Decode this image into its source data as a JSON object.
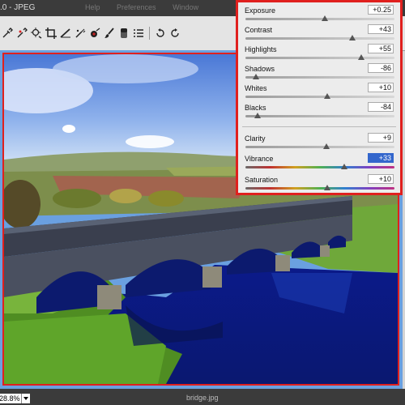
{
  "window": {
    "title": ".0 - JPEG",
    "menu_items": [
      "Help",
      "Preferences",
      "Window"
    ]
  },
  "toolbar": {
    "tools": [
      "zoom-icon",
      "eyedropper-icon",
      "color-sampler-icon",
      "targeted-adjust-icon",
      "crop-icon",
      "straighten-icon",
      "spot-removal-icon",
      "red-eye-icon",
      "adjustment-brush-icon",
      "graduated-filter-icon",
      "list-icon",
      "rotate-ccw-icon",
      "rotate-cw-icon"
    ]
  },
  "panel": {
    "sliders": [
      {
        "label": "Exposure",
        "value": "+0.25",
        "pos": 0.53,
        "track": "gray"
      },
      {
        "label": "Contrast",
        "value": "+43",
        "pos": 0.715,
        "track": "gray"
      },
      {
        "label": "Highlights",
        "value": "+55",
        "pos": 0.775,
        "track": "gray"
      },
      {
        "label": "Shadows",
        "value": "-86",
        "pos": 0.07,
        "track": "gray"
      },
      {
        "label": "Whites",
        "value": "+10",
        "pos": 0.55,
        "track": "gray"
      },
      {
        "label": "Blacks",
        "value": "-84",
        "pos": 0.08,
        "track": "gray"
      },
      {
        "label": "Clarity",
        "value": "+9",
        "pos": 0.545,
        "track": "gray"
      },
      {
        "label": "Vibrance",
        "value": "+33",
        "pos": 0.665,
        "track": "color",
        "selected": true
      },
      {
        "label": "Saturation",
        "value": "+10",
        "pos": 0.55,
        "track": "color"
      }
    ]
  },
  "status": {
    "zoom": "28.8%",
    "filename": "bridge.jpg"
  },
  "colors": {
    "highlight_border": "#e0201e",
    "selected_value": "#3366cc"
  }
}
